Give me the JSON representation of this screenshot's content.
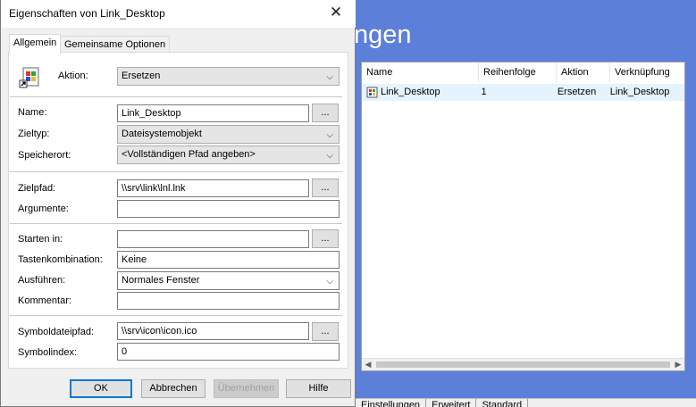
{
  "background": {
    "title_fragment": "ngen",
    "columns": [
      "Name",
      "Reihenfolge",
      "Aktion",
      "Verknüpfung"
    ],
    "row": {
      "icon": "shortcut-icon",
      "name": "Link_Desktop",
      "order": "1",
      "action": "Ersetzen",
      "link": "Link_Desktop"
    },
    "bottom_tabs": [
      "Einstellungen",
      "Erweitert",
      "Standard"
    ]
  },
  "dialog": {
    "title": "Eigenschaften von Link_Desktop",
    "close_glyph": "✕",
    "tabs": [
      "Allgemein",
      "Gemeinsame Optionen"
    ],
    "action": {
      "label": "Aktion:",
      "value": "Ersetzen"
    },
    "name": {
      "label": "Name:",
      "value": "Link_Desktop"
    },
    "target_type": {
      "label": "Zieltyp:",
      "value": "Dateisystemobjekt"
    },
    "location": {
      "label": "Speicherort:",
      "value": "<Vollständigen Pfad angeben>"
    },
    "target_path": {
      "label": "Zielpfad:",
      "value": "\\\\srv\\link\\lnl.lnk"
    },
    "arguments": {
      "label": "Argumente:",
      "value": ""
    },
    "start_in": {
      "label": "Starten in:",
      "value": ""
    },
    "hotkey": {
      "label": "Tastenkombination:",
      "value": "Keine"
    },
    "run": {
      "label": "Ausführen:",
      "value": "Normales Fenster"
    },
    "comment": {
      "label": "Kommentar:",
      "value": ""
    },
    "icon_path": {
      "label": "Symboldateipfad:",
      "value": "\\\\srv\\icon\\icon.ico"
    },
    "icon_index": {
      "label": "Symbolindex:",
      "value": "0"
    },
    "browse_label": "...",
    "buttons": {
      "ok": "OK",
      "cancel": "Abbrechen",
      "apply": "Übernehmen",
      "help": "Hilfe"
    }
  },
  "colors": {
    "accent": "#5c80d9",
    "selection": "#e5f3ff",
    "focus": "#0078d7"
  }
}
